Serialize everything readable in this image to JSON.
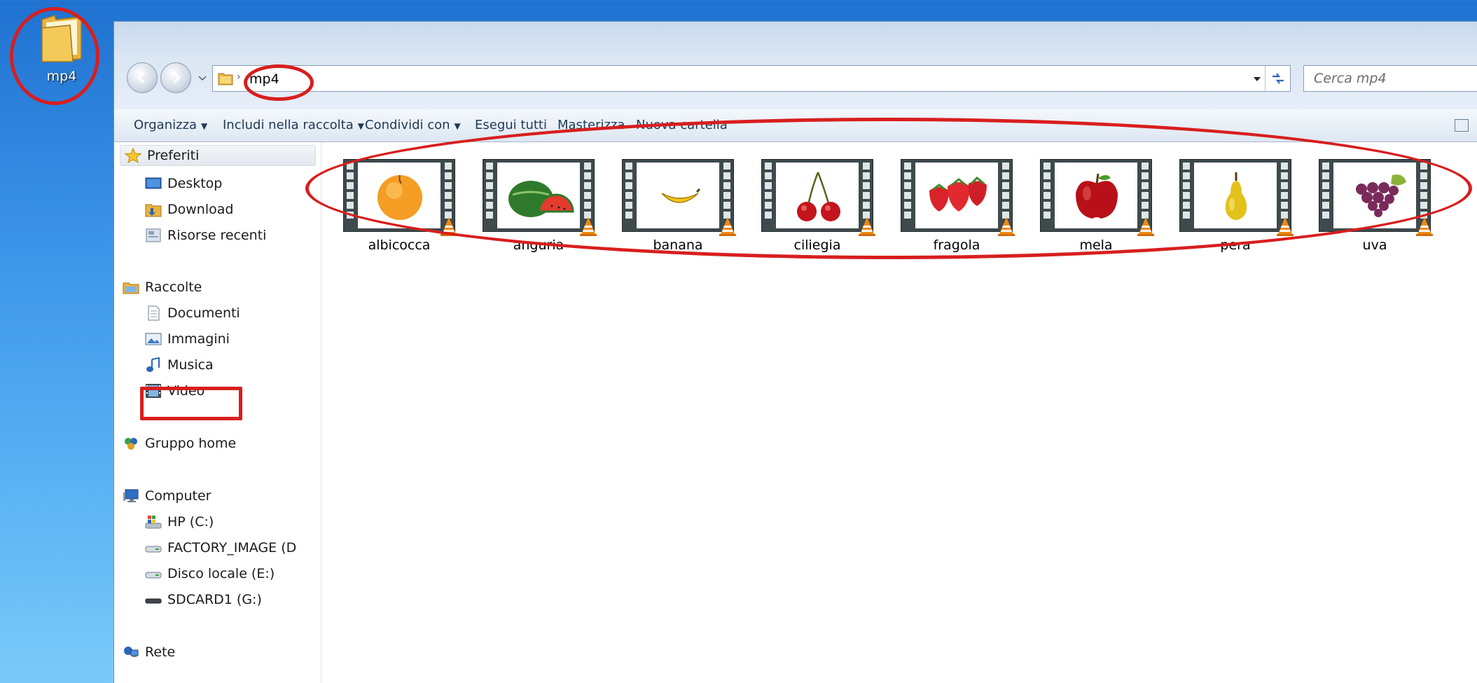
{
  "desktop": {
    "icon_label": "mp4"
  },
  "address_bar": {
    "path": "mp4"
  },
  "search": {
    "placeholder": "Cerca mp4"
  },
  "toolbar": {
    "organize": "Organizza",
    "include_library": "Includi nella raccolta",
    "share_with": "Condividi con",
    "play_all": "Esegui tutti",
    "burn": "Masterizza",
    "new_folder": "Nuova cartella"
  },
  "sidebar": {
    "favorites": "Preferiti",
    "desktop": "Desktop",
    "download": "Download",
    "recent": "Risorse recenti",
    "libraries": "Raccolte",
    "documents": "Documenti",
    "images": "Immagini",
    "music": "Musica",
    "video": "Video",
    "homegroup": "Gruppo home",
    "computer": "Computer",
    "drive_c": "HP (C:)",
    "drive_d": "FACTORY_IMAGE (D",
    "drive_e": "Disco locale (E:)",
    "drive_g": "SDCARD1 (G:)",
    "network": "Rete"
  },
  "files": [
    {
      "name": "albicocca",
      "fruit": "apricot"
    },
    {
      "name": "anguria",
      "fruit": "watermelon"
    },
    {
      "name": "banana",
      "fruit": "banana"
    },
    {
      "name": "ciliegia",
      "fruit": "cherry"
    },
    {
      "name": "fragola",
      "fruit": "strawberry"
    },
    {
      "name": "mela",
      "fruit": "apple"
    },
    {
      "name": "pera",
      "fruit": "pear"
    },
    {
      "name": "uva",
      "fruit": "grapes"
    }
  ],
  "colors": {
    "annotation": "#d81e1e",
    "desktop_top": "#1f72d0",
    "desktop_bottom": "#7bcaf9"
  }
}
